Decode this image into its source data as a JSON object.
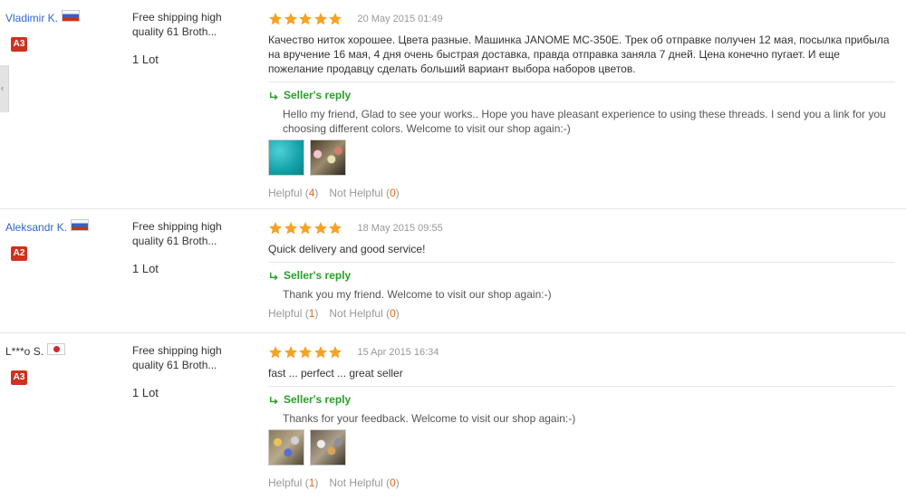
{
  "icons": {
    "star": "star-icon",
    "reply": "reply-arrow-icon",
    "side_tab": "chevron-left-icon"
  },
  "colors": {
    "star": "#f7a223",
    "link": "#3366cc",
    "reply": "#2a9f2a",
    "badge": "#d0311d",
    "count": "#e46a1b"
  },
  "reviews": [
    {
      "user": "Vladimir K.",
      "country": "Russia",
      "badge": "A3",
      "product": "Free shipping high quality 61 Broth...",
      "qty": "1 Lot",
      "rating": 5,
      "date": "20 May 2015 01:49",
      "text": "Качество ниток хорошее. Цвета разные. Машинка JANOME MC-350E. Трек об отправке получен 12 мая, посылка прибыла на вручение 16 мая, 4 дня очень быстрая доставка, правда отправка заняла 7 дней. Цена конечно пугает. И еще пожелание продавцу сделать больший вариант выбора наборов цветов.",
      "reply_label": "Seller's reply",
      "reply": "Hello my friend, Glad to see your works.. Hope you have pleasant experience to using these threads. I send you a link for you choosing different colors. Welcome to visit our shop again:-)",
      "helpful_label": "Helpful",
      "helpful": "4",
      "not_helpful_label": "Not Helpful",
      "not_helpful": "0"
    },
    {
      "user": "Aleksandr K.",
      "country": "Russia",
      "badge": "A2",
      "product": "Free shipping high quality 61 Broth...",
      "qty": "1 Lot",
      "rating": 5,
      "date": "18 May 2015 09:55",
      "text": "Quick delivery and good service!",
      "reply_label": "Seller's reply",
      "reply": "Thank you my friend. Welcome to visit our shop again:-)",
      "helpful_label": "Helpful",
      "helpful": "1",
      "not_helpful_label": "Not Helpful",
      "not_helpful": "0"
    },
    {
      "user": "L***o S.",
      "country": "Japan",
      "badge": "A3",
      "product": "Free shipping high quality 61 Broth...",
      "qty": "1 Lot",
      "rating": 5,
      "date": "15 Apr 2015 16:34",
      "text": "fast ... perfect ... great seller",
      "reply_label": "Seller's reply",
      "reply": "Thanks for your feedback. Welcome to visit our shop again:-)",
      "helpful_label": "Helpful",
      "helpful": "1",
      "not_helpful_label": "Not Helpful",
      "not_helpful": "0"
    }
  ]
}
